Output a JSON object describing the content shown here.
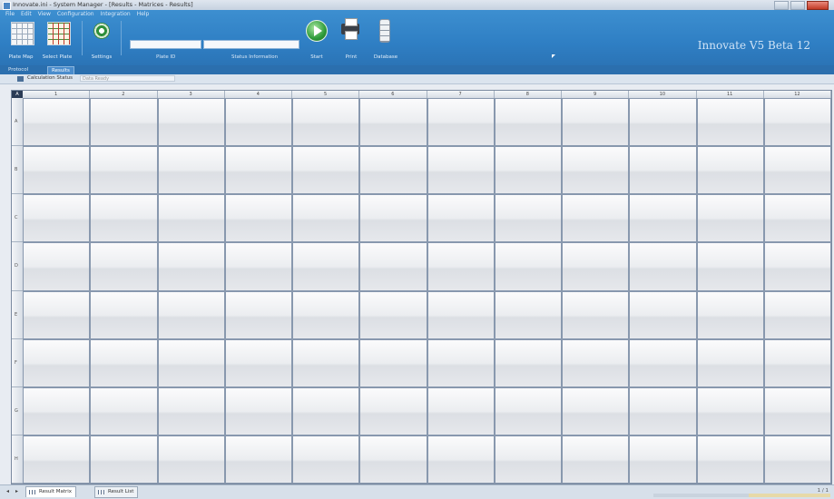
{
  "window": {
    "title": "Innovate.ini - System Manager - [Results - Matrices - Results]"
  },
  "menu": [
    "File",
    "Edit",
    "View",
    "Configuration",
    "Integration",
    "Help"
  ],
  "ribbon": {
    "buttons": {
      "plate_map": "Plate Map",
      "select_plate": "Select Plate",
      "settings": "Settings",
      "start": "Start",
      "print": "Print",
      "database": "Database"
    },
    "fields": {
      "plate_id": "Plate ID",
      "status_information": "Status Information"
    },
    "brand": "Innovate V5 Beta 12"
  },
  "tabs": [
    "Protocol",
    "Results"
  ],
  "calculation": {
    "label": "Calculation Status",
    "value": "Data Ready"
  },
  "plate": {
    "corner": "A",
    "columns": [
      "1",
      "2",
      "3",
      "4",
      "5",
      "6",
      "7",
      "8",
      "9",
      "10",
      "11",
      "12"
    ],
    "rows": [
      "A",
      "B",
      "C",
      "D",
      "E",
      "F",
      "G",
      "H"
    ]
  },
  "bottom": {
    "tabs": [
      "Result Matrix",
      "Result List"
    ],
    "pager": "1 / 1"
  },
  "colors": {
    "ribbon": "#2f7fc4",
    "cell_border": "#8898ae",
    "header": "#d7dde5"
  }
}
